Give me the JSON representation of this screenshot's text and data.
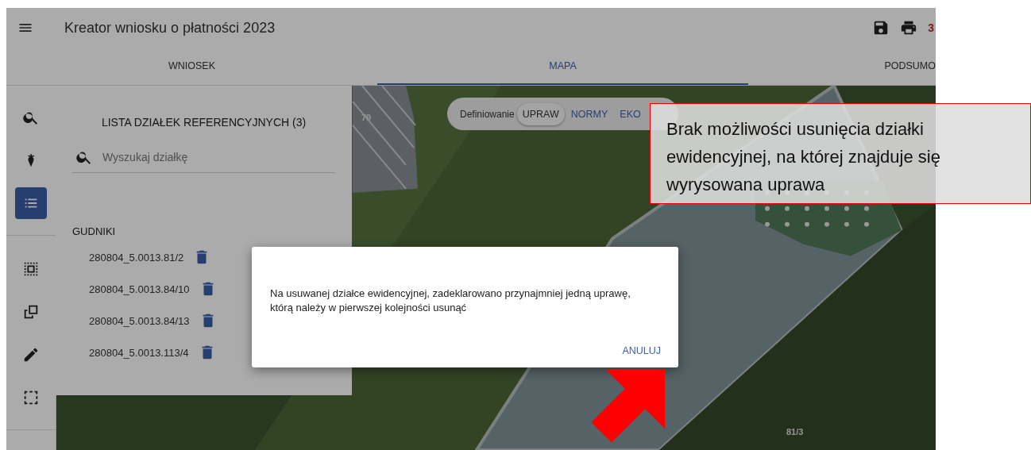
{
  "header": {
    "title": "Kreator wniosku o płatności 2023",
    "badge": "3"
  },
  "tabs": [
    {
      "label": "WNIOSEK",
      "selected": false
    },
    {
      "label": "MAPA",
      "selected": true
    },
    {
      "label": "PODSUMO",
      "selected": false
    }
  ],
  "rail": {
    "top": [
      {
        "kind": "search",
        "selected": false
      },
      {
        "kind": "crop",
        "selected": false
      },
      {
        "kind": "list",
        "selected": true
      }
    ],
    "bottom": [
      {
        "kind": "select",
        "selected": false
      },
      {
        "kind": "copy",
        "selected": false
      },
      {
        "kind": "edit",
        "selected": false
      },
      {
        "kind": "rect",
        "selected": false
      }
    ]
  },
  "panel": {
    "title": "LISTA DZIAŁEK REFERENCYJNYCH (3)",
    "search": {
      "placeholder": "Wyszukaj działkę"
    },
    "groups": [
      {
        "name": "GUDNIKI",
        "parcels": [
          {
            "id": "280804_5.0013.81/2"
          },
          {
            "id": "280804_5.0013.84/10"
          },
          {
            "id": "280804_5.0013.84/13"
          },
          {
            "id": "280804_5.0013.113/4"
          }
        ]
      }
    ]
  },
  "map": {
    "mode_toggle": {
      "label": "Definiowanie",
      "options": [
        {
          "label": "UPRAW",
          "selected": true
        },
        {
          "label": "NORMY",
          "selected": false
        },
        {
          "label": "EKO",
          "selected": false
        }
      ]
    },
    "labels": [
      "79",
      "81/3"
    ]
  },
  "dialog": {
    "message": "Na usuwanej działce ewidencyjnej, zadeklarowano przynajmniej jedną uprawę, którą należy w pierwszej kolejności usunąć",
    "button": "ANULUJ"
  },
  "callout": {
    "text": "Brak możliwości usunięcia działki ewidencyjnej, na której znajduje się wyrysowana uprawa"
  }
}
